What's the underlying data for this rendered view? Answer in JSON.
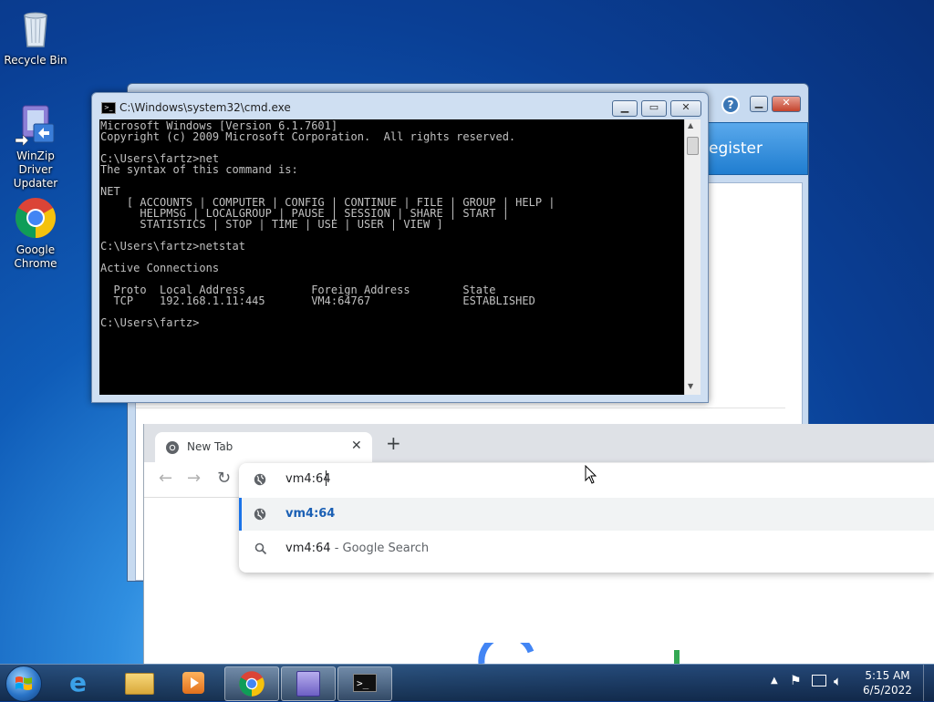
{
  "desktop": {
    "icons": [
      {
        "label_line1": "Recycle Bin",
        "label_line2": ""
      },
      {
        "label_line1": "WinZip Driver",
        "label_line2": "Updater"
      },
      {
        "label_line1": "Google",
        "label_line2": "Chrome"
      }
    ]
  },
  "background_window": {
    "register_label": "egister",
    "help_label": "?"
  },
  "cmd": {
    "title": "C:\\Windows\\system32\\cmd.exe",
    "lines": [
      "Microsoft Windows [Version 6.1.7601]",
      "Copyright (c) 2009 Microsoft Corporation.  All rights reserved.",
      "",
      "C:\\Users\\fartz>net",
      "The syntax of this command is:",
      "",
      "NET",
      "    [ ACCOUNTS | COMPUTER | CONFIG | CONTINUE | FILE | GROUP | HELP |",
      "      HELPMSG | LOCALGROUP | PAUSE | SESSION | SHARE | START |",
      "      STATISTICS | STOP | TIME | USE | USER | VIEW ]",
      "",
      "C:\\Users\\fartz>netstat",
      "",
      "Active Connections",
      "",
      "  Proto  Local Address          Foreign Address        State",
      "  TCP    192.168.1.11:445       VM4:64767              ESTABLISHED",
      "",
      "C:\\Users\\fartz>"
    ]
  },
  "chrome": {
    "tab_title": "New Tab",
    "omnibox_value": "vm4:64",
    "suggestions": [
      {
        "main": "vm4:64",
        "suffix": "",
        "icon": "globe-icon"
      },
      {
        "main": "vm4:64",
        "suffix": " - Google Search",
        "icon": "search-icon"
      }
    ]
  },
  "taskbar": {
    "time": "5:15 AM",
    "date": "6/5/2022"
  },
  "colors": {
    "accent_blue": "#1a73e8",
    "suggestion_text": "#1a5fb4"
  }
}
